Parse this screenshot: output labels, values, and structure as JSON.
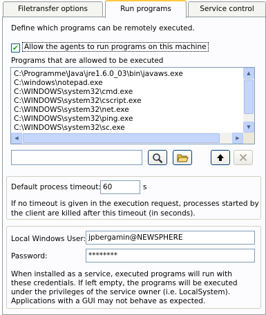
{
  "tabs": [
    {
      "label": "Filetransfer options"
    },
    {
      "label": "Run programs"
    },
    {
      "label": "Service control"
    }
  ],
  "description": "Define which programs can be remotely executed.",
  "allow_agents": {
    "label": "Allow the agents to run programs on this machine",
    "checked": true,
    "check_glyph": "✔"
  },
  "programs_label": "Programs that are allowed to be executed",
  "programs": [
    "C:\\Programme\\Java\\jre1.6.0_03\\bin\\javaws.exe",
    "C:\\windows\\notepad.exe",
    "C:\\WINDOWS\\system32\\cmd.exe",
    "C:\\WINDOWS\\system32\\cscript.exe",
    "C:\\WINDOWS\\system32\\net.exe",
    "C:\\WINDOWS\\system32\\ping.exe",
    "C:\\WINDOWS\\system32\\sc.exe"
  ],
  "program_input": {
    "value": ""
  },
  "buttons": {
    "search_icon": "magnifier-icon",
    "open_icon": "folder-open-icon",
    "up_icon": "arrow-up-icon",
    "remove_icon": "cross-icon",
    "remove_disabled": true
  },
  "timeout": {
    "label": "Default process timeout:",
    "value": "60",
    "unit": "s",
    "note_line1": "If no timeout is given in the execution request, processes started by",
    "note_line2": "the client are killed after this timeout (in seconds)."
  },
  "credentials": {
    "user_label": "Local Windows User:",
    "user_value": "jpbergamin@NEWSPHERE",
    "password_label": "Password:",
    "password_value": "********",
    "note_line1": "When installed as a service, executed programs will run with",
    "note_line2": "these credentials. If left empty, the programs will be executed",
    "note_line3": "under the privileges of the service owner (i.e. LocalSystem).",
    "note_line4": "Applications with a GUI may not behave as expected."
  },
  "colors": {
    "tab_highlight": "#ffc83c",
    "border": "#919b9c",
    "field_border": "#7f9db9"
  }
}
